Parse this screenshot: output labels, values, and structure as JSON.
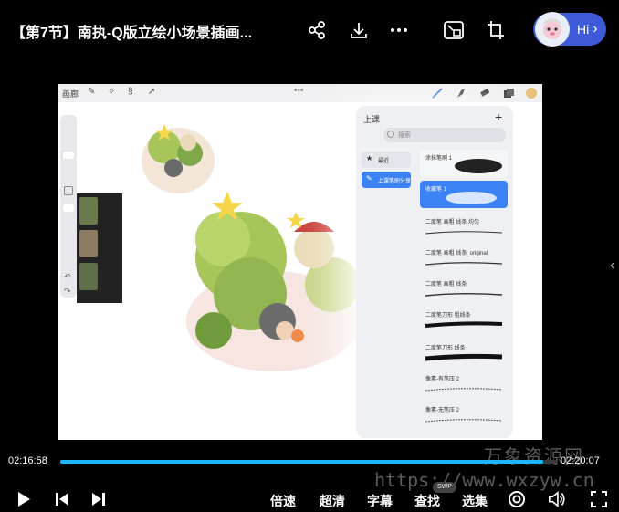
{
  "header": {
    "title": "【第7节】南执-Q版立绘小场景插画...",
    "hi_label": "Hi",
    "icons": [
      "share-icon",
      "download-icon",
      "more-icon",
      "pip-icon",
      "crop-icon"
    ]
  },
  "video": {
    "procreate": {
      "gallery_label": "画廊",
      "brush_library": {
        "title": "上课",
        "search_placeholder": "搜索",
        "categories": [
          {
            "label": "最近",
            "active": false
          },
          {
            "label": "上课笔刷分享",
            "active": true
          }
        ],
        "brushes": [
          {
            "label": "涂抹笔刷 1",
            "selected": false
          },
          {
            "label": "收藏笔 1",
            "selected": true
          },
          {
            "label": "二度笔 画粗 线条 均匀",
            "selected": false
          },
          {
            "label": "二度笔 画粗 线条_original",
            "selected": false
          },
          {
            "label": "二度笔 画粗 线条",
            "selected": false
          },
          {
            "label": "二度笔刀形 粗线条",
            "selected": false
          },
          {
            "label": "二度笔刀形 线条",
            "selected": false
          },
          {
            "label": "像素-有笔压 2",
            "selected": false
          },
          {
            "label": "像素-无笔压 2",
            "selected": false
          }
        ]
      }
    }
  },
  "player": {
    "current_time": "02:16:58",
    "total_time": "02:20:07",
    "progress": 0.972,
    "controls": {
      "speed": "倍速",
      "quality": "超清",
      "subtitle": "字幕",
      "search": "查找",
      "episodes": "选集",
      "swp": "SWP"
    },
    "colors": {
      "progress": "#1fb6ff"
    }
  },
  "watermark": {
    "brand": "万象资源网",
    "url": "https://www.wxzyw.cn"
  }
}
